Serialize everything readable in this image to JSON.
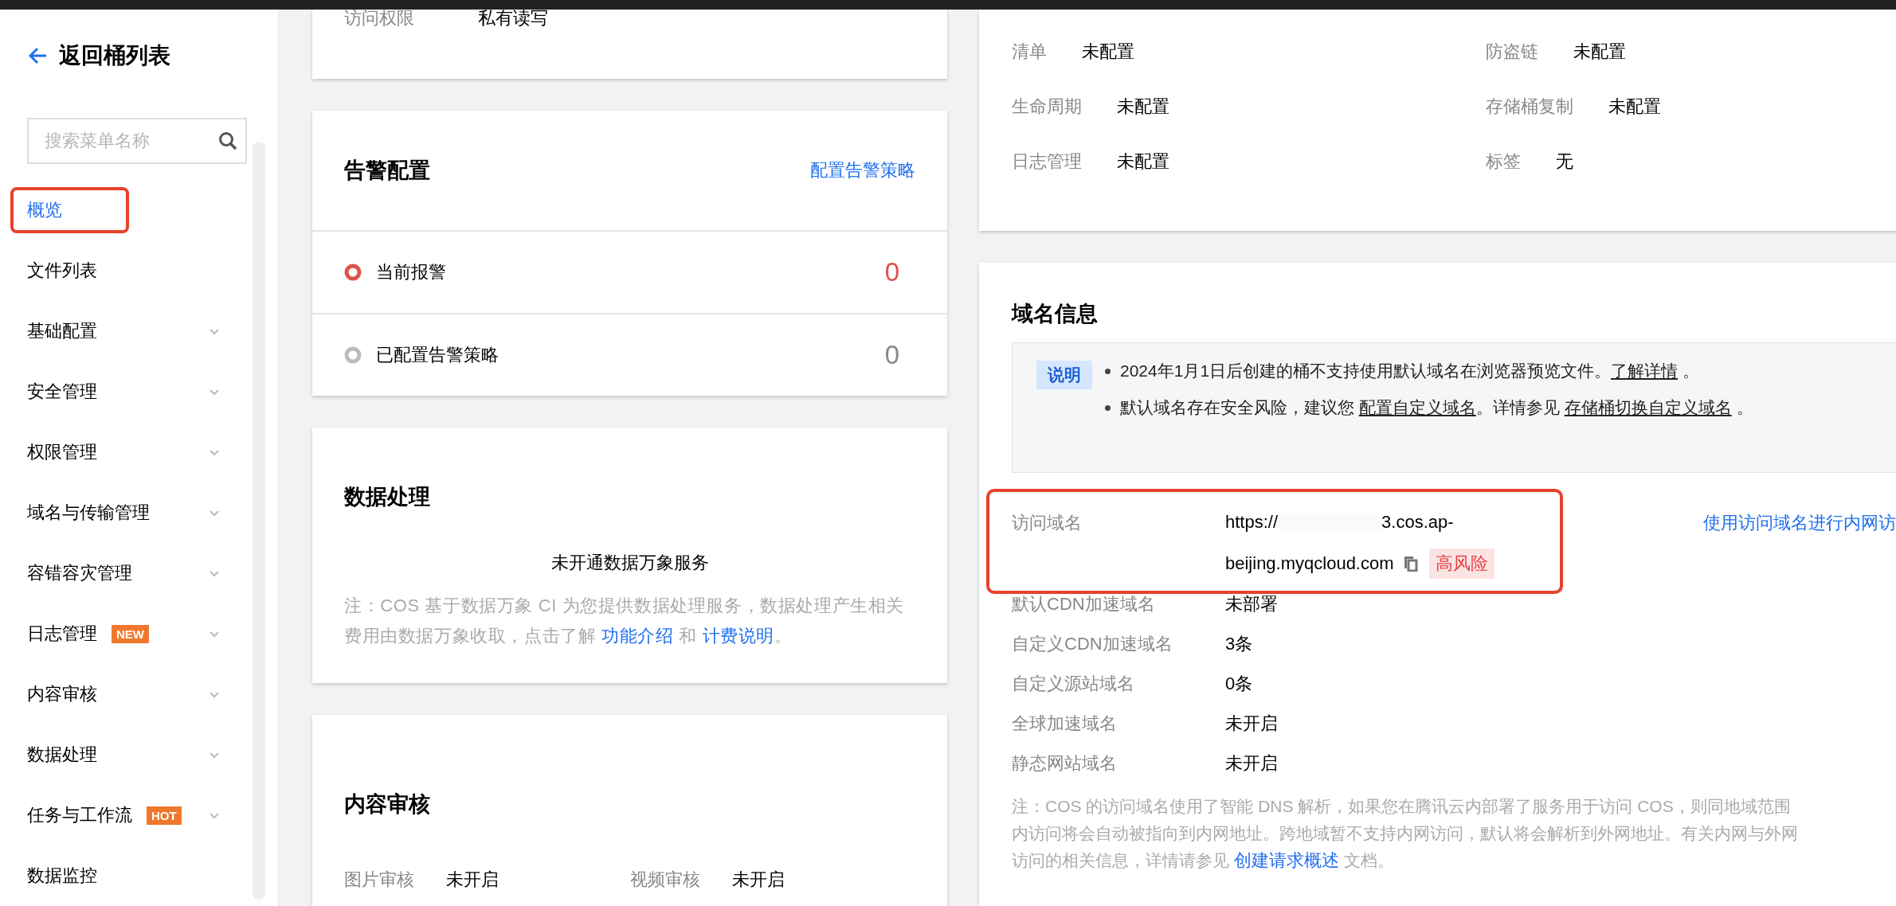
{
  "sidebar": {
    "back_label": "返回桶列表",
    "search": {
      "placeholder": "搜索菜单名称"
    },
    "items": [
      {
        "label": "概览",
        "selected": true,
        "highlighted": true,
        "expandable": false
      },
      {
        "label": "文件列表",
        "selected": false,
        "highlighted": false,
        "expandable": false
      },
      {
        "label": "基础配置",
        "selected": false,
        "highlighted": false,
        "expandable": true
      },
      {
        "label": "安全管理",
        "selected": false,
        "highlighted": false,
        "expandable": true
      },
      {
        "label": "权限管理",
        "selected": false,
        "highlighted": false,
        "expandable": true
      },
      {
        "label": "域名与传输管理",
        "selected": false,
        "highlighted": false,
        "expandable": true
      },
      {
        "label": "容错容灾管理",
        "selected": false,
        "highlighted": false,
        "expandable": true
      },
      {
        "label": "日志管理",
        "selected": false,
        "highlighted": false,
        "expandable": true,
        "badge": "NEW"
      },
      {
        "label": "内容审核",
        "selected": false,
        "highlighted": false,
        "expandable": true
      },
      {
        "label": "数据处理",
        "selected": false,
        "highlighted": false,
        "expandable": true
      },
      {
        "label": "任务与工作流",
        "selected": false,
        "highlighted": false,
        "expandable": true,
        "badge": "HOT"
      },
      {
        "label": "数据监控",
        "selected": false,
        "highlighted": false,
        "expandable": false
      }
    ]
  },
  "permission_card": {
    "label": "访问权限",
    "value": "私有读写"
  },
  "alarm_card": {
    "title": "告警配置",
    "link": "配置告警策略",
    "items": [
      {
        "label": "当前报警",
        "count": "0",
        "kind": "current",
        "color": "#e0514c"
      },
      {
        "label": "已配置告警策略",
        "count": "0",
        "kind": "configured",
        "color": "#bbbbbb"
      }
    ]
  },
  "data_processing_card": {
    "title": "数据处理",
    "status": "未开通数据万象服务",
    "note": [
      {
        "kind": "text",
        "text": "注：COS 基于数据万象 CI 为您提供数据处理服务，数据处理产生相关费用由数据万象收取，点击了解 "
      },
      {
        "kind": "link",
        "text": "功能介绍"
      },
      {
        "kind": "text",
        "text": " 和 "
      },
      {
        "kind": "link",
        "text": "计费说明"
      },
      {
        "kind": "text",
        "text": "。"
      }
    ]
  },
  "content_review_card": {
    "title": "内容审核",
    "fields": [
      {
        "label": "图片审核",
        "value": "未开启"
      },
      {
        "label": "视频审核",
        "value": "未开启"
      }
    ]
  },
  "config_card": {
    "fields": [
      {
        "label": "清单",
        "value": "未配置"
      },
      {
        "label": "防盗链",
        "value": "未配置"
      },
      {
        "label": "生命周期",
        "value": "未配置"
      },
      {
        "label": "存储桶复制",
        "value": "未配置"
      },
      {
        "label": "日志管理",
        "value": "未配置"
      },
      {
        "label": "标签",
        "value": "无"
      }
    ]
  },
  "domain_card": {
    "title": "域名信息",
    "notice": {
      "tag": "说明",
      "items": [
        [
          {
            "kind": "text",
            "text": "2024年1月1日后创建的桶不支持使用默认域名在浏览器预览文件。"
          },
          {
            "kind": "link",
            "text": "了解详情"
          },
          {
            "kind": "text",
            "text": " 。"
          }
        ],
        [
          {
            "kind": "text",
            "text": "默认域名存在安全风险，建议您 "
          },
          {
            "kind": "link",
            "text": "配置自定义域名"
          },
          {
            "kind": "text",
            "text": "。详情参见 "
          },
          {
            "kind": "link",
            "text": "存储桶切换自定义域名"
          },
          {
            "kind": "text",
            "text": " 。"
          }
        ]
      ]
    },
    "access_domain": {
      "label": "访问域名",
      "highlighted": true,
      "url_start": "https://",
      "url_end": "3.cos.ap-",
      "url_line2": "beijing.myqcloud.com",
      "risk": "高风险",
      "side_link": "使用访问域名进行内网访"
    },
    "rows": [
      {
        "label": "默认CDN加速域名",
        "value": "未部署"
      },
      {
        "label": "自定义CDN加速域名",
        "value": "3条"
      },
      {
        "label": "自定义源站域名",
        "value": "0条"
      },
      {
        "label": "全球加速域名",
        "value": "未开启"
      },
      {
        "label": "静态网站域名",
        "value": "未开启"
      }
    ],
    "note": [
      {
        "kind": "text",
        "text": "注：COS 的访问域名使用了智能 DNS 解析，如果您在腾讯云内部署了服务用于访问 COS，则同地域范围"
      },
      {
        "kind": "br"
      },
      {
        "kind": "text",
        "text": "内访问将会自动被指向到内网地址。跨地域暂不支持内网访问，默认将会解析到外网地址。有关内网与外网"
      },
      {
        "kind": "br"
      },
      {
        "kind": "text",
        "text": "访问的相关信息，详情请参见 "
      },
      {
        "kind": "link",
        "text": "创建请求概述"
      },
      {
        "kind": "text",
        "text": " 文档。"
      }
    ]
  }
}
